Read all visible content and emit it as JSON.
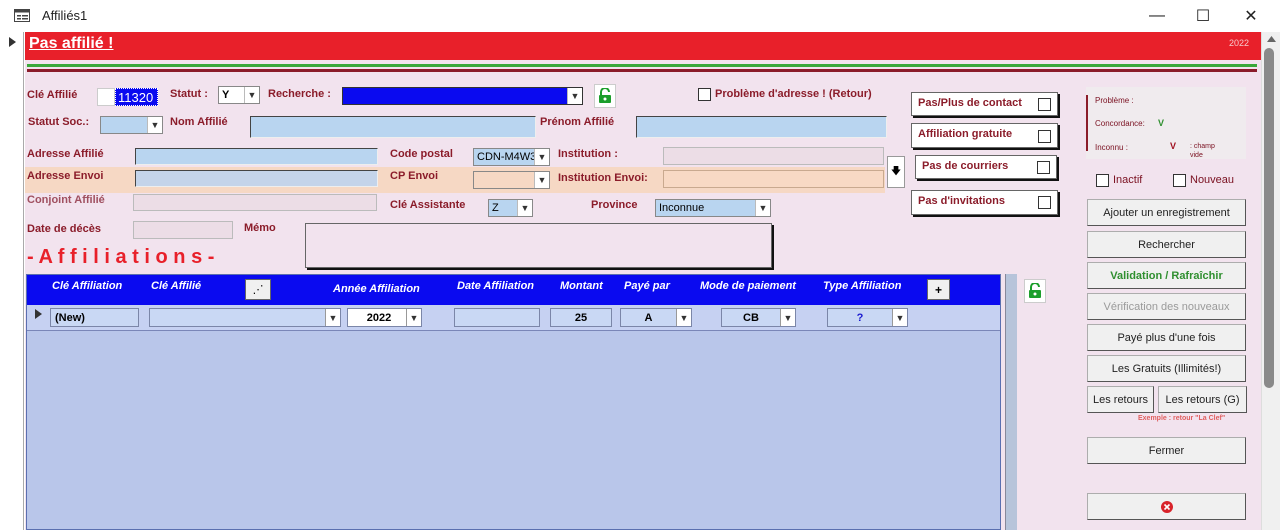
{
  "window": {
    "title": "Affiliés1",
    "minimize": "—",
    "maximize": "☐",
    "close": "✕"
  },
  "header": {
    "title": "Pas affilié !",
    "year": "2022"
  },
  "fields": {
    "cle_affilie_label": "Clé Affilié",
    "cle_affilie_value": "11320",
    "statut_label": "Statut :",
    "statut_value": "Y",
    "recherche_label": "Recherche :",
    "probleme_adresse_label": "Problème d'adresse ! (Retour)",
    "statut_soc_label": "Statut Soc.:",
    "nom_affilie_label": "Nom Affilié",
    "prenom_affilie_label": "Prénom Affilié",
    "adresse_affilie_label": "Adresse Affilié",
    "code_postal_label": "Code postal",
    "code_postal_value": "CDN-M4W3",
    "institution_label": "Institution :",
    "adresse_envoi_label": "Adresse Envoi",
    "cp_envoi_label": "CP Envoi",
    "institution_envoi_label": "Institution Envoi:",
    "conjoint_label": "Conjoint Affilié",
    "cle_assistante_label": "Clé Assistante",
    "cle_assistante_value": "Z",
    "province_label": "Province",
    "province_value": "Inconnue",
    "date_deces_label": "Date de décès",
    "memo_label": "Mémo",
    "affiliations_title": "- A f f i l i a t i o n s -"
  },
  "options": {
    "pas_plus_contact": "Pas/Plus de contact",
    "affiliation_gratuite": "Affiliation gratuite",
    "pas_courriers": "Pas de courriers",
    "pas_invitations": "Pas d'invitations"
  },
  "legend": {
    "probleme": "Problème :",
    "concordance": "Concordance:",
    "concordance_mark": "V",
    "inconnu": "Inconnu :",
    "inconnu_mark": "V",
    "champ": ": champ",
    "vide": "vide"
  },
  "flags": {
    "inactif": "Inactif",
    "nouveau": "Nouveau"
  },
  "buttons": {
    "ajouter": "Ajouter un enregistrement",
    "rechercher": "Rechercher",
    "validation": "Validation / Rafraîchir",
    "verification": "Vérification des nouveaux",
    "paye_plus": "Payé plus d'une fois",
    "gratuits": "Les Gratuits (Illimités!)",
    "retours": "Les retours",
    "retours_g": "Les retours (G)",
    "exemple": "Exemple : retour \"La Clef\"",
    "fermer": "Fermer"
  },
  "subform": {
    "columns": [
      "Clé Affiliation",
      "Clé Affilié",
      "Année Affiliation",
      "Date Affiliation",
      "Montant",
      "Payé par",
      "Mode de paiement",
      "Type Affiliation"
    ],
    "add_label": "+",
    "row": {
      "cle_affiliation": "(New)",
      "annee": "2022",
      "montant": "25",
      "paye_par": "A",
      "mode": "CB",
      "type": "?"
    }
  },
  "colors": {
    "header_red": "#e8202a",
    "label_red": "#8b1c2a",
    "sub_blue": "#0a0af0",
    "field_blue": "#b9d5f0"
  }
}
